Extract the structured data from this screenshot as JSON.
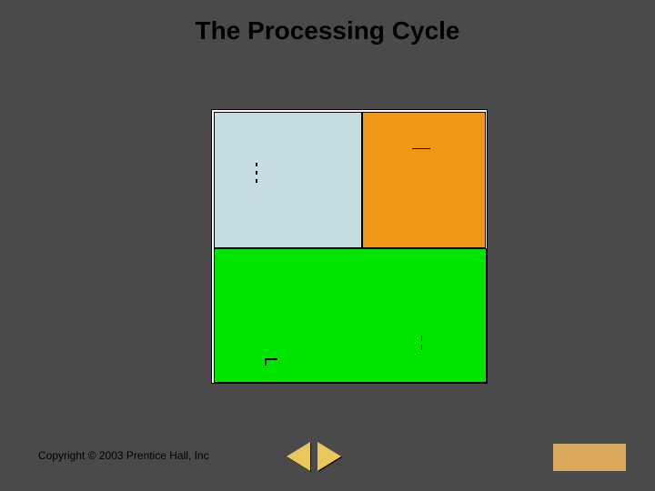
{
  "title": "The Processing Cycle",
  "copyright": "Copyright © 2003 Prentice Hall, Inc",
  "colors": {
    "bg": "#4a4a4a",
    "quad_tl": "#c5dce0",
    "quad_tr": "#f29618",
    "quad_b": "#00e500",
    "nav": "#e8c858",
    "box": "#daa85a"
  }
}
